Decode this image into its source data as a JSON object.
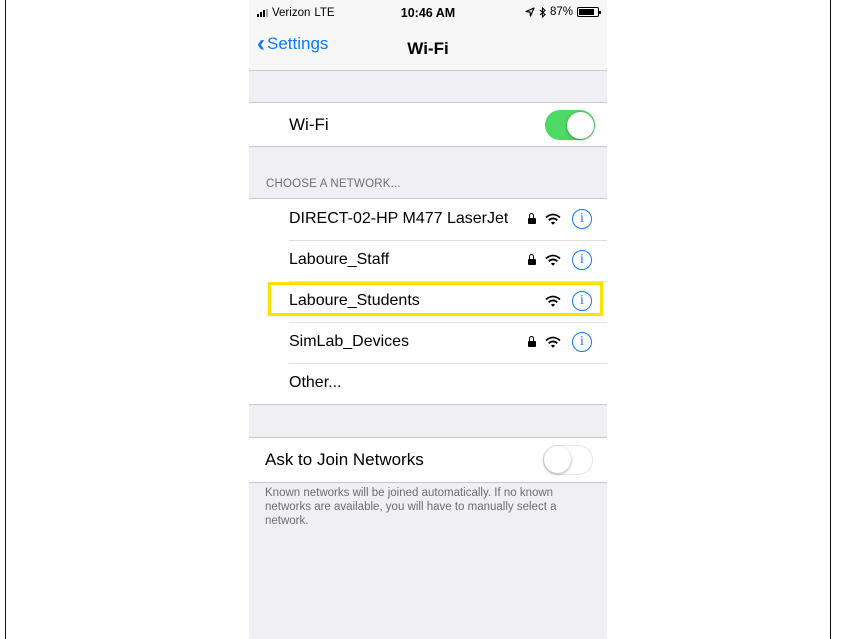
{
  "status_bar": {
    "carrier": "Verizon",
    "network_type": "LTE",
    "time": "10:46 AM",
    "battery_percent": "87%",
    "battery_level": 0.87,
    "icons": [
      "signal-icon",
      "location-arrow-icon",
      "bluetooth-icon",
      "battery-icon"
    ]
  },
  "nav": {
    "back_label": "Settings",
    "title": "Wi-Fi"
  },
  "wifi_toggle": {
    "label": "Wi-Fi",
    "state": "on",
    "color": "#4cd964"
  },
  "networks": {
    "header": "CHOOSE A NETWORK...",
    "items": [
      {
        "name": "DIRECT-02-HP M477 LaserJet",
        "locked": true
      },
      {
        "name": "Laboure_Staff",
        "locked": true
      },
      {
        "name": "Laboure_Students",
        "locked": false,
        "highlighted": true
      },
      {
        "name": "SimLab_Devices",
        "locked": true
      }
    ],
    "other_label": "Other..."
  },
  "ask_to_join": {
    "label": "Ask to Join Networks",
    "state": "off",
    "footer": "Known networks will be joined automatically. If no known networks are available, you will have to manually select a network."
  },
  "colors": {
    "accent": "#0a7aff",
    "highlight": "#ffe100",
    "background": "#efeff4"
  }
}
